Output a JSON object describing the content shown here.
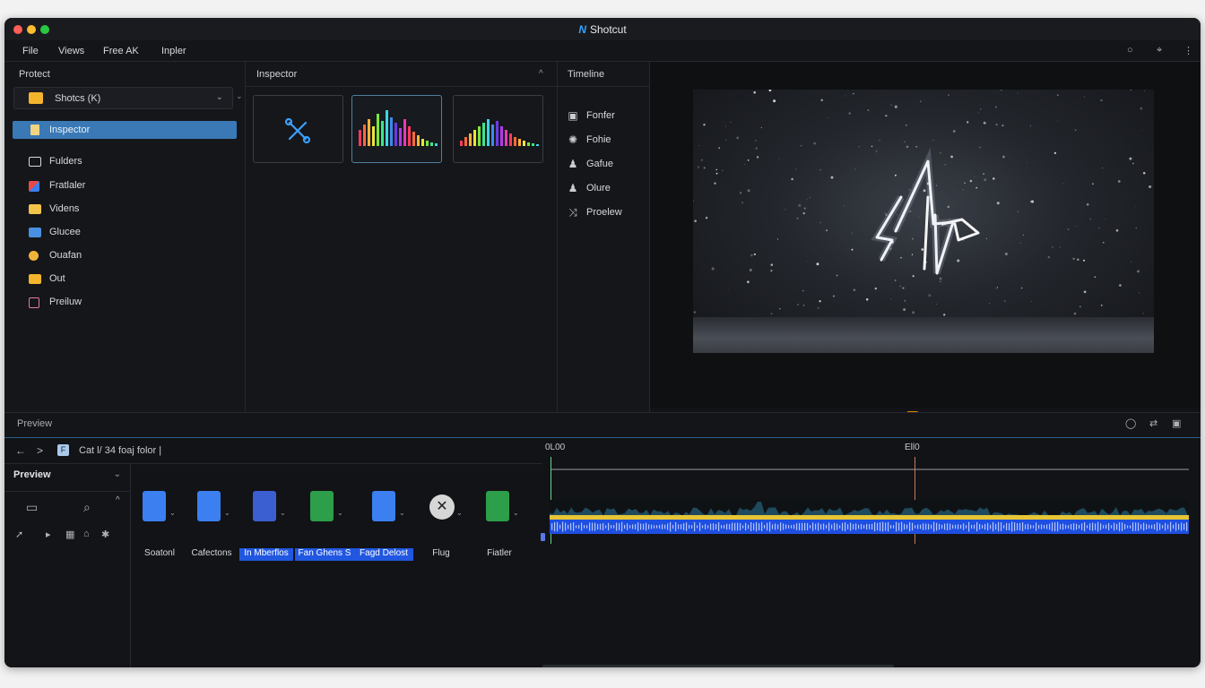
{
  "window": {
    "title": "Shotcut",
    "logo_text": "N"
  },
  "menu": {
    "items": [
      "File",
      "Views",
      "Free AK",
      "Inpler"
    ],
    "right_icons": [
      "circle-icon",
      "pin-icon",
      "more-icon"
    ]
  },
  "project": {
    "title": "Protect",
    "dropdown_label": "Shotcs (K)",
    "selected_item": "Inspector",
    "items": [
      {
        "label": "Fulders",
        "icon": "folder-outline-icon",
        "color": "#d6d9de"
      },
      {
        "label": "Fratlaler",
        "icon": "multicolor-icon",
        "color": "#e84a4a"
      },
      {
        "label": "Videns",
        "icon": "folder-icon",
        "color": "#f3c44a"
      },
      {
        "label": "Glucee",
        "icon": "folder-blue-icon",
        "color": "#4a90e2"
      },
      {
        "label": "Ouafan",
        "icon": "chrome-icon",
        "color": "#f0b43a"
      },
      {
        "label": "Out",
        "icon": "folder-icon",
        "color": "#f3b52b"
      },
      {
        "label": "Preiluw",
        "icon": "preview-icon",
        "color": "#e07aa5"
      }
    ]
  },
  "inspector": {
    "title": "Inspector",
    "collapse_glyph": "^"
  },
  "timeline_panel": {
    "title": "Timeline",
    "items": [
      {
        "label": "Fonfer",
        "icon": "image-icon"
      },
      {
        "label": "Fohie",
        "icon": "gear-icon"
      },
      {
        "label": "Gafue",
        "icon": "person-icon"
      },
      {
        "label": "Olure",
        "icon": "person-icon"
      },
      {
        "label": "Proelew",
        "icon": "transition-icon"
      }
    ]
  },
  "transport": {
    "buttons": [
      "skip-back-icon",
      "frame-back-icon",
      "play-icon",
      "skip-forward-icon"
    ],
    "right_glyph": "⇹"
  },
  "preview_panel": {
    "title": "Preview",
    "controls": [
      "circle-icon",
      "swap-icon",
      "display-icon"
    ]
  },
  "navigation": {
    "back": "←",
    "forward": ">",
    "path": "Cat l/ 34 foaj folor |"
  },
  "preview_sidebar": {
    "title": "Preview"
  },
  "files": [
    {
      "label": "Soatonl",
      "color": "#3b7ff0",
      "highlighted": false
    },
    {
      "label": "Cafectons",
      "color": "#3b7ff0",
      "highlighted": false
    },
    {
      "label": "In Mberflos",
      "color": "#3b5fd0",
      "highlighted": true
    },
    {
      "label": "Fan Ghens S",
      "color": "#2d9e4a",
      "highlighted": true
    },
    {
      "label": "Fagd Delost",
      "color": "#3b7ff0",
      "highlighted": true
    },
    {
      "label": "Flug",
      "color": "#d6d6d6",
      "highlighted": false
    },
    {
      "label": "Fiatler",
      "color": "#2d9e4a",
      "highlighted": false
    }
  ],
  "timeline": {
    "ruler_labels": [
      "0L00",
      "Ell0"
    ]
  }
}
